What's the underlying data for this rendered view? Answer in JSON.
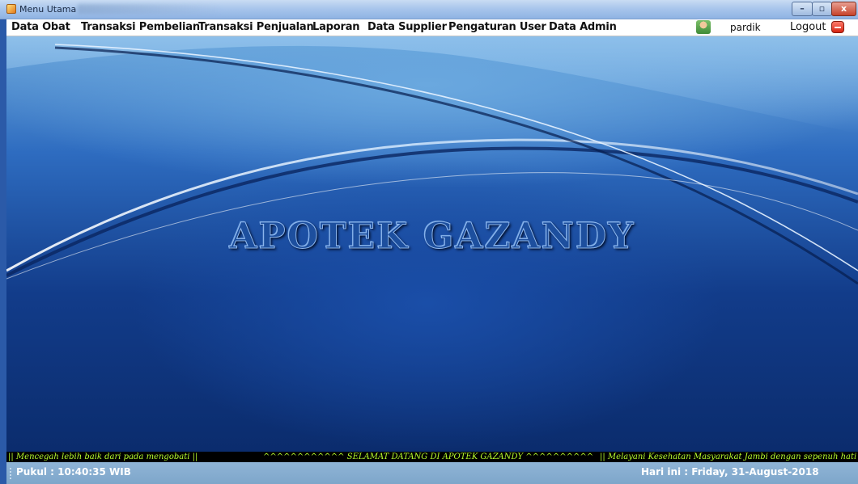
{
  "window": {
    "title": "Menu Utama",
    "minimize_label": "–",
    "maximize_label": "▫",
    "close_label": "x"
  },
  "menu": {
    "items": [
      {
        "label": "Data Obat"
      },
      {
        "label": "Transaksi Pembelian"
      },
      {
        "label": "Transaksi Penjualan"
      },
      {
        "label": "Laporan"
      },
      {
        "label": "Data Supplier"
      },
      {
        "label": "Pengaturan User"
      },
      {
        "label": "Data Admin"
      }
    ],
    "user_icon": "user-avatar-icon",
    "user_name": "pardik",
    "logout_label": "Logout",
    "logout_icon": "logout-icon"
  },
  "main": {
    "brand_title": "APOTEK GAZANDY"
  },
  "marquee": {
    "left": "|| Mencegah lebih baik dari pada mengobati ||",
    "center": "^^^^^^^^^^^^  SELAMAT DATANG DI APOTEK GAZANDY  ^^^^^^^^^^",
    "right": "|| Melayani Kesehatan Masyarakat Jambi dengan sepenuh hati"
  },
  "status": {
    "time": "Pukul : 10:40:35 WIB",
    "date": "Hari ini : Friday, 31-August-2018"
  },
  "colors": {
    "marquee_text": "#b9ff2e",
    "background_blue": "#123c8a",
    "status_bar": "#8fb4d6"
  }
}
